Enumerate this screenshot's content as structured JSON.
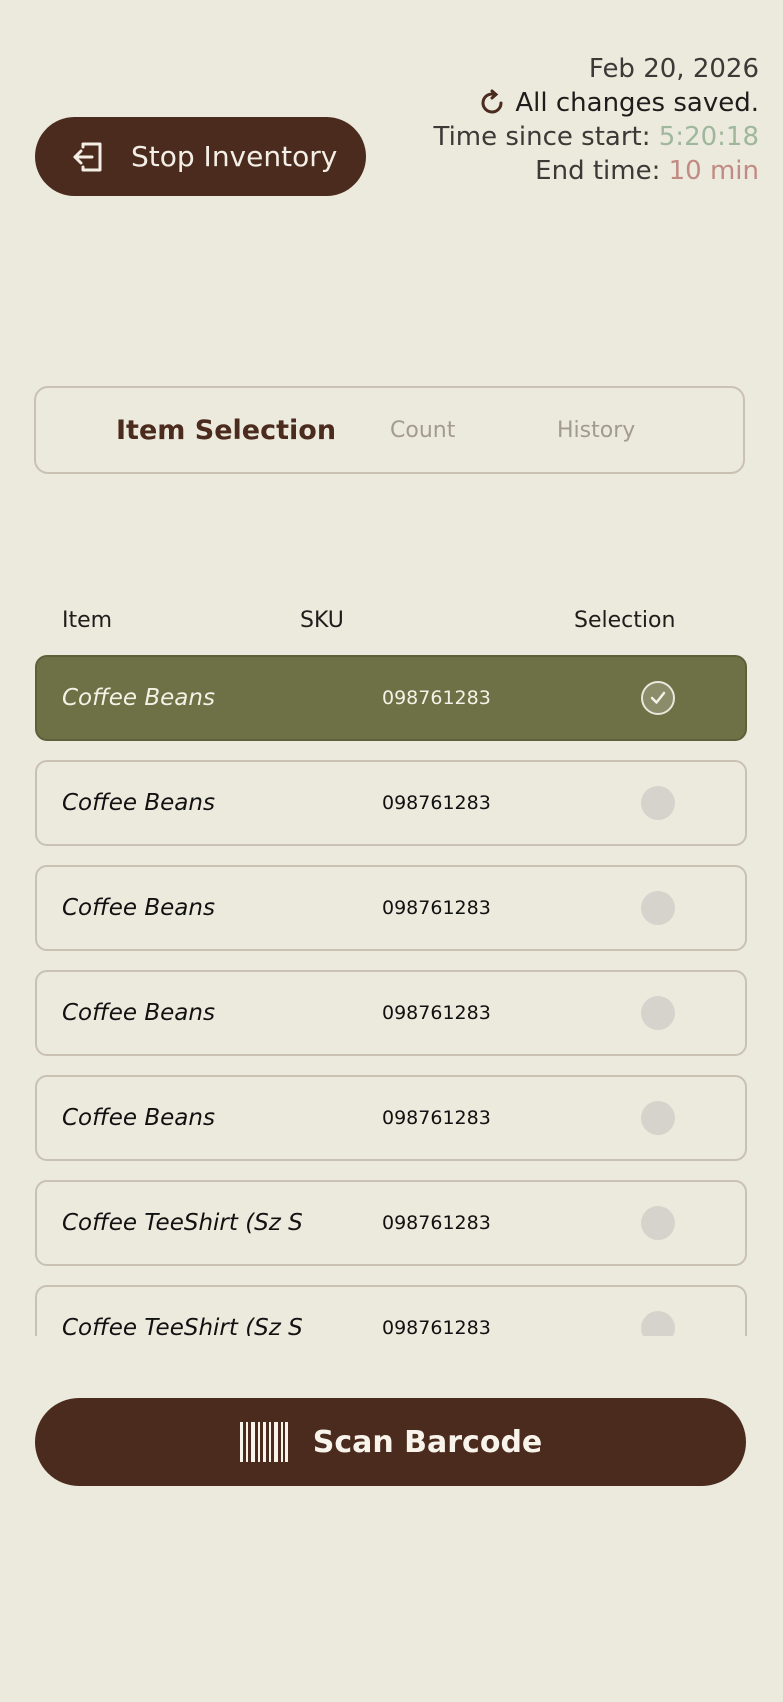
{
  "header": {
    "stop_label": "Stop Inventory",
    "date": "Feb 20, 2026",
    "save_status": "All changes saved.",
    "time_since_label": "Time since start:",
    "time_since_value": "5:20:18",
    "end_time_label": "End time:",
    "end_time_value": "10 min"
  },
  "tabs": [
    {
      "label": "Item Selection",
      "active": true
    },
    {
      "label": "Count",
      "active": false
    },
    {
      "label": "History",
      "active": false
    }
  ],
  "table": {
    "headers": {
      "item": "Item",
      "sku": "SKU",
      "selection": "Selection"
    },
    "rows": [
      {
        "name": "Coffee Beans",
        "sku": "098761283",
        "selected": true
      },
      {
        "name": "Coffee Beans",
        "sku": "098761283",
        "selected": false
      },
      {
        "name": "Coffee Beans",
        "sku": "098761283",
        "selected": false
      },
      {
        "name": "Coffee Beans",
        "sku": "098761283",
        "selected": false
      },
      {
        "name": "Coffee Beans",
        "sku": "098761283",
        "selected": false
      },
      {
        "name": "Coffee TeeShirt (Sz S",
        "sku": "098761283",
        "selected": false
      },
      {
        "name": "Coffee TeeShirt (Sz S",
        "sku": "098761283",
        "selected": false
      }
    ]
  },
  "scan": {
    "label": "Scan Barcode"
  },
  "icons": {
    "stop": "exit-icon",
    "saved": "refresh-icon",
    "scan": "barcode-icon",
    "check": "check-icon"
  },
  "colors": {
    "background": "#ece9dd",
    "primary": "#4b2b1e",
    "selected_row": "#6e7045",
    "elapsed": "#9fb89b",
    "end_time": "#c08b84"
  }
}
